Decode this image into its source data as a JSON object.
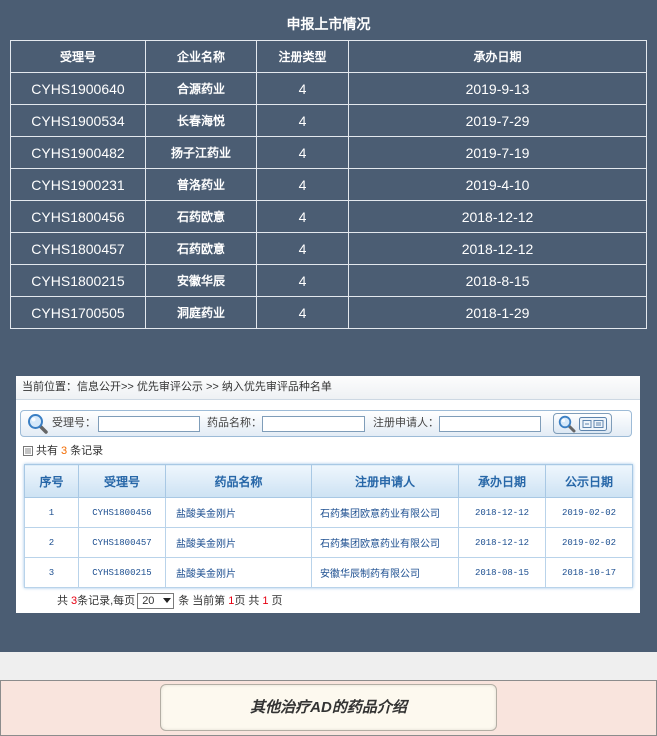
{
  "market": {
    "title": "申报上市情况",
    "columns": [
      "受理号",
      "企业名称",
      "注册类型",
      "承办日期"
    ],
    "rows": [
      {
        "accept_no": "CYHS1900640",
        "company": "合源药业",
        "reg_type": "4",
        "date": "2019-9-13"
      },
      {
        "accept_no": "CYHS1900534",
        "company": "长春海悦",
        "reg_type": "4",
        "date": "2019-7-29"
      },
      {
        "accept_no": "CYHS1900482",
        "company": "扬子江药业",
        "reg_type": "4",
        "date": "2019-7-19"
      },
      {
        "accept_no": "CYHS1900231",
        "company": "普洛药业",
        "reg_type": "4",
        "date": "2019-4-10"
      },
      {
        "accept_no": "CYHS1800456",
        "company": "石药欧意",
        "reg_type": "4",
        "date": "2018-12-12"
      },
      {
        "accept_no": "CYHS1800457",
        "company": "石药欧意",
        "reg_type": "4",
        "date": "2018-12-12"
      },
      {
        "accept_no": "CYHS1800215",
        "company": "安徽华辰",
        "reg_type": "4",
        "date": "2018-8-15"
      },
      {
        "accept_no": "CYHS1700505",
        "company": "洞庭药业",
        "reg_type": "4",
        "date": "2018-1-29"
      }
    ]
  },
  "priority_review": {
    "breadcrumb": "当前位置：信息公开>> 优先审评公示 >> 纳入优先审评品种名单",
    "search": {
      "accept_no_label": "受理号：",
      "accept_no_value": "",
      "drug_name_label": "药品名称：",
      "drug_name_value": "",
      "applicant_label": "注册申请人：",
      "applicant_value": ""
    },
    "record_summary": {
      "prefix": "共有",
      "count": "3",
      "suffix": "条记录"
    },
    "table": {
      "columns": [
        "序号",
        "受理号",
        "药品名称",
        "注册申请人",
        "承办日期",
        "公示日期"
      ],
      "rows": [
        {
          "index": "1",
          "accept_no": "CYHS1800456",
          "drug_name": "盐酸美金刚片",
          "applicant": "石药集团欧意药业有限公司",
          "undertake_date": "2018-12-12",
          "publicity_date": "2019-02-02"
        },
        {
          "index": "2",
          "accept_no": "CYHS1800457",
          "drug_name": "盐酸美金刚片",
          "applicant": "石药集团欧意药业有限公司",
          "undertake_date": "2018-12-12",
          "publicity_date": "2019-02-02"
        },
        {
          "index": "3",
          "accept_no": "CYHS1800215",
          "drug_name": "盐酸美金刚片",
          "applicant": "安徽华辰制药有限公司",
          "undertake_date": "2018-08-15",
          "publicity_date": "2018-10-17"
        }
      ]
    },
    "pagination": {
      "total_prefix": "共",
      "total_records": "3",
      "per_page_label": "条记录,每页",
      "page_size": "20",
      "page_size_unit": "条",
      "current_page_prefix": "当前第",
      "current_page": "1",
      "current_page_suffix": "页",
      "total_pages_prefix": "共",
      "total_pages": "1",
      "total_pages_suffix": "页"
    }
  },
  "footer": {
    "more_link_label": "其他治疗AD的药品介绍"
  },
  "icons": {
    "search_bar_icon": "search-icon",
    "search_button_icon": "magnifier-icon",
    "search_button_secondary_icon": "query-icon",
    "record_summary_icon": "list-icon",
    "page_size_dropdown_icon": "chevron-down-icon"
  },
  "colors": {
    "page_background": "#4b5d73",
    "embedded_header_text": "#2767a8",
    "embedded_cell_text": "#1d4f90",
    "count_highlight": "#f26b00",
    "page_highlight": "#e60012",
    "footer_panel": "#f9e4dd",
    "footer_button": "#fdf9ef"
  }
}
